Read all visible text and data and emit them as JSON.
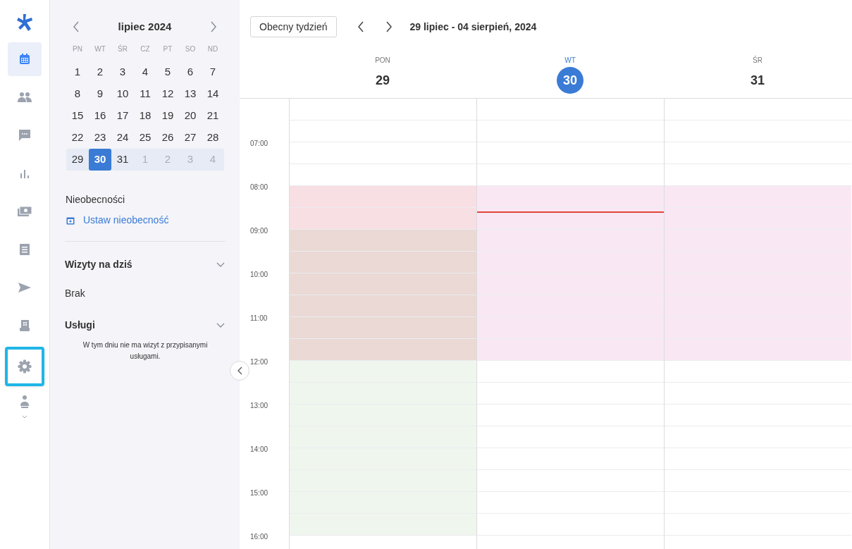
{
  "nav": [
    {
      "selected": true,
      "highlighted": false
    },
    {
      "selected": false,
      "highlighted": false
    },
    {
      "selected": false,
      "highlighted": false
    },
    {
      "selected": false,
      "highlighted": false
    },
    {
      "selected": false,
      "highlighted": false
    },
    {
      "selected": false,
      "highlighted": false
    },
    {
      "selected": false,
      "highlighted": false
    },
    {
      "selected": false,
      "highlighted": false
    },
    {
      "selected": false,
      "highlighted": true
    },
    {
      "selected": false,
      "highlighted": false
    }
  ],
  "mini_calendar": {
    "title": "lipiec 2024",
    "weekdays": [
      "PN",
      "WT",
      "ŚR",
      "CZ",
      "PT",
      "SO",
      "ND"
    ],
    "weeks": [
      {
        "in_current_week": false,
        "days": [
          {
            "label": "1",
            "other_month": false,
            "selected": false
          },
          {
            "label": "2",
            "other_month": false,
            "selected": false
          },
          {
            "label": "3",
            "other_month": false,
            "selected": false
          },
          {
            "label": "4",
            "other_month": false,
            "selected": false
          },
          {
            "label": "5",
            "other_month": false,
            "selected": false
          },
          {
            "label": "6",
            "other_month": false,
            "selected": false
          },
          {
            "label": "7",
            "other_month": false,
            "selected": false
          }
        ]
      },
      {
        "in_current_week": false,
        "days": [
          {
            "label": "8",
            "other_month": false,
            "selected": false
          },
          {
            "label": "9",
            "other_month": false,
            "selected": false
          },
          {
            "label": "10",
            "other_month": false,
            "selected": false
          },
          {
            "label": "11",
            "other_month": false,
            "selected": false
          },
          {
            "label": "12",
            "other_month": false,
            "selected": false
          },
          {
            "label": "13",
            "other_month": false,
            "selected": false
          },
          {
            "label": "14",
            "other_month": false,
            "selected": false
          }
        ]
      },
      {
        "in_current_week": false,
        "days": [
          {
            "label": "15",
            "other_month": false,
            "selected": false
          },
          {
            "label": "16",
            "other_month": false,
            "selected": false
          },
          {
            "label": "17",
            "other_month": false,
            "selected": false
          },
          {
            "label": "18",
            "other_month": false,
            "selected": false
          },
          {
            "label": "19",
            "other_month": false,
            "selected": false
          },
          {
            "label": "20",
            "other_month": false,
            "selected": false
          },
          {
            "label": "21",
            "other_month": false,
            "selected": false
          }
        ]
      },
      {
        "in_current_week": false,
        "days": [
          {
            "label": "22",
            "other_month": false,
            "selected": false
          },
          {
            "label": "23",
            "other_month": false,
            "selected": false
          },
          {
            "label": "24",
            "other_month": false,
            "selected": false
          },
          {
            "label": "25",
            "other_month": false,
            "selected": false
          },
          {
            "label": "26",
            "other_month": false,
            "selected": false
          },
          {
            "label": "27",
            "other_month": false,
            "selected": false
          },
          {
            "label": "28",
            "other_month": false,
            "selected": false
          }
        ]
      },
      {
        "in_current_week": true,
        "days": [
          {
            "label": "29",
            "other_month": false,
            "selected": false
          },
          {
            "label": "30",
            "other_month": false,
            "selected": true
          },
          {
            "label": "31",
            "other_month": false,
            "selected": false
          },
          {
            "label": "1",
            "other_month": true,
            "selected": false
          },
          {
            "label": "2",
            "other_month": true,
            "selected": false
          },
          {
            "label": "3",
            "other_month": true,
            "selected": false
          },
          {
            "label": "4",
            "other_month": true,
            "selected": false
          }
        ]
      }
    ]
  },
  "absences": {
    "title": "Nieobecności",
    "link": "Ustaw nieobecność"
  },
  "sections": [
    {
      "title": "Wizyty na dziś",
      "expanded": true,
      "text": "Brak",
      "kind": "plain"
    },
    {
      "title": "Usługi",
      "expanded": true,
      "text": "W tym dniu nie ma wizyt z przypisanymi usługami.",
      "kind": "note"
    }
  ],
  "toolbar": {
    "today_button": "Obecny tydzień",
    "range": "29 lipiec - 04 sierpień, 2024"
  },
  "hours": [
    "07:00",
    "08:00",
    "09:00",
    "10:00",
    "11:00",
    "12:00",
    "13:00",
    "14:00",
    "15:00",
    "16:00"
  ],
  "days": [
    {
      "weekday": "PON",
      "date": "29",
      "today": false,
      "slots": [
        {
          "color": "#ffffff"
        },
        {
          "color": "#ffffff"
        },
        {
          "color": "#ffffff"
        },
        {
          "color": "#ffffff"
        },
        {
          "color": "#f8dfe4"
        },
        {
          "color": "#f8dfe4"
        },
        {
          "color": "#ead9d5"
        },
        {
          "color": "#ead9d5"
        },
        {
          "color": "#ead9d5"
        },
        {
          "color": "#ead9d5"
        },
        {
          "color": "#ead9d5"
        },
        {
          "color": "#ead9d5"
        },
        {
          "color": "#eef6ee"
        },
        {
          "color": "#eef6ee"
        },
        {
          "color": "#eef6ee"
        },
        {
          "color": "#eef6ee"
        },
        {
          "color": "#eef6ee"
        },
        {
          "color": "#eef6ee"
        },
        {
          "color": "#eef6ee"
        },
        {
          "color": "#eef6ee"
        }
      ]
    },
    {
      "weekday": "WT",
      "date": "30",
      "today": true,
      "slots": [
        {
          "color": "#ffffff"
        },
        {
          "color": "#ffffff"
        },
        {
          "color": "#ffffff"
        },
        {
          "color": "#ffffff"
        },
        {
          "color": "#f9e8f3"
        },
        {
          "color": "#f9e8f3"
        },
        {
          "color": "#f9e8f3"
        },
        {
          "color": "#f9e8f3"
        },
        {
          "color": "#f9e8f3"
        },
        {
          "color": "#f9e8f3"
        },
        {
          "color": "#f9e8f3"
        },
        {
          "color": "#f9e8f3"
        },
        {
          "color": "#ffffff"
        },
        {
          "color": "#ffffff"
        },
        {
          "color": "#ffffff"
        },
        {
          "color": "#ffffff"
        },
        {
          "color": "#ffffff"
        },
        {
          "color": "#ffffff"
        },
        {
          "color": "#ffffff"
        },
        {
          "color": "#ffffff"
        }
      ]
    },
    {
      "weekday": "ŚR",
      "date": "31",
      "today": false,
      "slots": [
        {
          "color": "#ffffff"
        },
        {
          "color": "#ffffff"
        },
        {
          "color": "#ffffff"
        },
        {
          "color": "#ffffff"
        },
        {
          "color": "#f9e8f3"
        },
        {
          "color": "#f9e8f3"
        },
        {
          "color": "#f9e8f3"
        },
        {
          "color": "#f9e8f3"
        },
        {
          "color": "#f9e8f3"
        },
        {
          "color": "#f9e8f3"
        },
        {
          "color": "#f9e8f3"
        },
        {
          "color": "#f9e8f3"
        },
        {
          "color": "#ffffff"
        },
        {
          "color": "#ffffff"
        },
        {
          "color": "#ffffff"
        },
        {
          "color": "#ffffff"
        },
        {
          "color": "#ffffff"
        },
        {
          "color": "#ffffff"
        },
        {
          "color": "#ffffff"
        },
        {
          "color": "#ffffff"
        }
      ]
    }
  ]
}
